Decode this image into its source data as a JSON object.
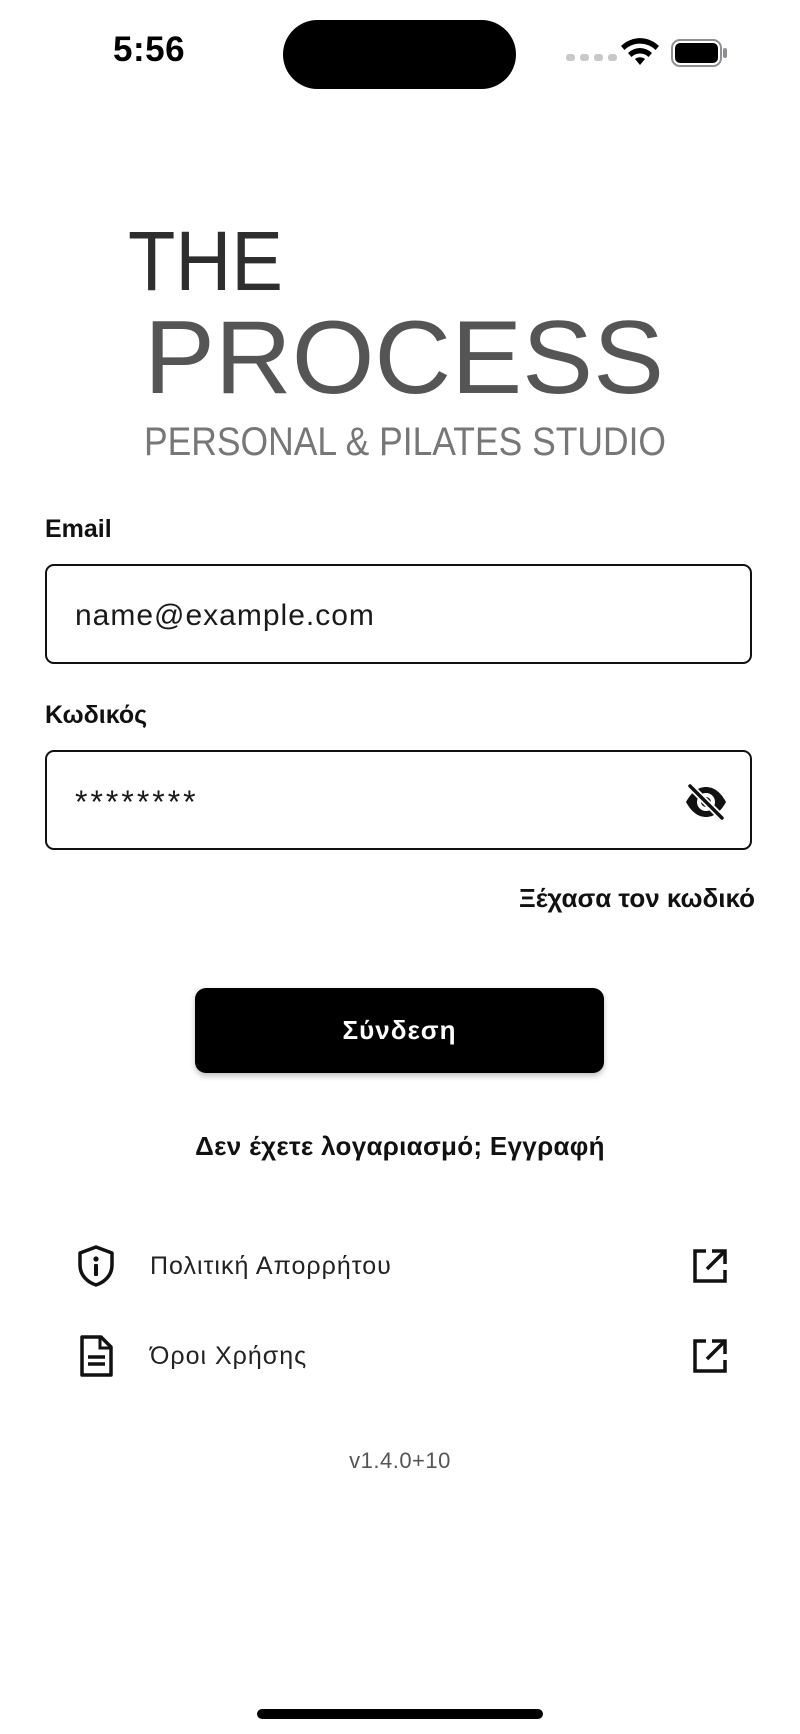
{
  "status_bar": {
    "time": "5:56"
  },
  "logo": {
    "line1": "THE",
    "line2": "PROCESS",
    "tagline": "PERSONAL & PILATES STUDIO"
  },
  "form": {
    "email": {
      "label": "Email",
      "value": "name@example.com"
    },
    "password": {
      "label": "Κωδικός",
      "value": "********",
      "toggle_icon": "eye-off-icon"
    },
    "forgot_link": "Ξέχασα τον κωδικό",
    "login_button": "Σύνδεση",
    "register_prompt": "Δεν έχετε λογαριασμό; Εγγραφή"
  },
  "links": [
    {
      "label": "Πολιτική Απορρήτου",
      "icon": "shield-info-icon",
      "action_icon": "open-external-icon"
    },
    {
      "label": "Όροι Χρήσης",
      "icon": "document-icon",
      "action_icon": "open-external-icon"
    }
  ],
  "version": "v1.4.0+10",
  "colors": {
    "primary": "#000000",
    "background": "#ffffff",
    "logo_dark": "#333333",
    "logo_grey": "#7a7a7a"
  }
}
